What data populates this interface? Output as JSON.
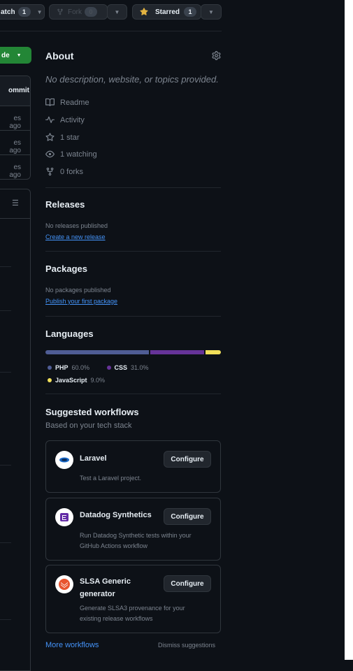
{
  "header": {
    "watch_label": "atch",
    "watch_count": "1",
    "fork_label": "Fork",
    "fork_count": "0",
    "star_label": "Starred",
    "star_count": "1"
  },
  "left": {
    "code_button": "de",
    "commit_header": "ommit",
    "rows": [
      "es ago",
      "es ago",
      "es ago"
    ]
  },
  "about": {
    "title": "About",
    "description": "No description, website, or topics provided.",
    "items": [
      "Readme",
      "Activity",
      "1 star",
      "1 watching",
      "0 forks"
    ]
  },
  "releases": {
    "title": "Releases",
    "empty": "No releases published",
    "link": "Create a new release"
  },
  "packages": {
    "title": "Packages",
    "empty": "No packages published",
    "link": "Publish your first package"
  },
  "languages": {
    "title": "Languages",
    "items": [
      {
        "name": "PHP",
        "percent": "60.0%",
        "value": 60.0,
        "color": "#4F5D95"
      },
      {
        "name": "CSS",
        "percent": "31.0%",
        "value": 31.0,
        "color": "#663399"
      },
      {
        "name": "JavaScript",
        "percent": "9.0%",
        "value": 9.0,
        "color": "#f1e05a"
      }
    ]
  },
  "workflows": {
    "title": "Suggested workflows",
    "subtitle": "Based on your tech stack",
    "configure_label": "Configure",
    "items": [
      {
        "name": "Laravel",
        "desc1": "Test a Laravel project.",
        "desc2": ""
      },
      {
        "name": "Datadog Synthetics",
        "desc1": "Run Datadog Synthetic tests within your",
        "desc2": "GitHub Actions workflow"
      },
      {
        "name1": "SLSA Generic",
        "name2": "generator",
        "desc1": "Generate SLSA3 provenance for your",
        "desc2": "existing release workflows"
      }
    ],
    "more_link": "More workflows",
    "dismiss_link": "Dismiss suggestions"
  },
  "colors": {
    "background": "#0d1117",
    "accent_green": "#238636",
    "link": "#4493f8",
    "star": "#e3b341"
  }
}
